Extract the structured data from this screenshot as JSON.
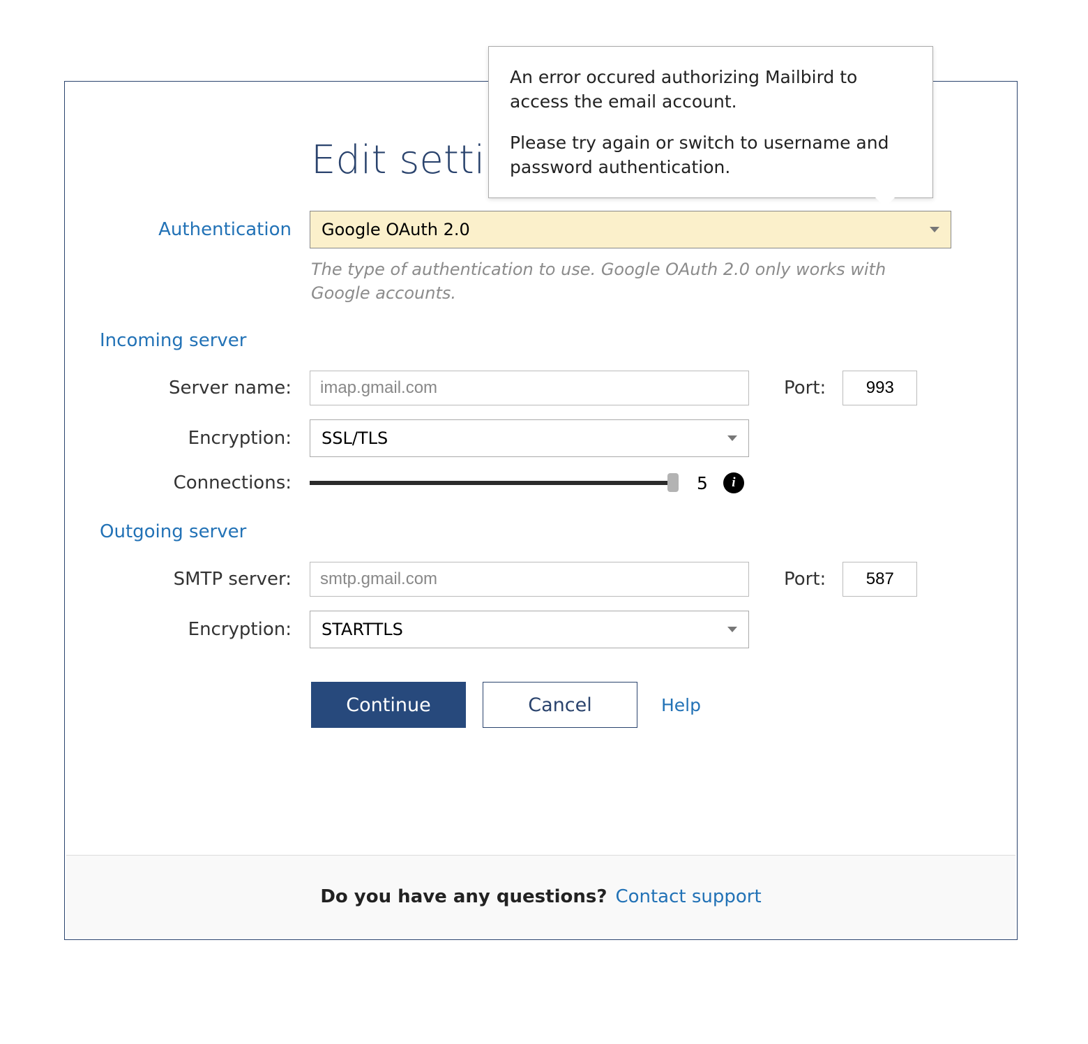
{
  "title": "Edit settings",
  "tooltip": {
    "line1": "An error occured authorizing Mailbird to access the email account.",
    "line2": "Please try again or switch to username and password authentication."
  },
  "auth": {
    "label": "Authentication",
    "value": "Google OAuth 2.0",
    "helper": "The type of authentication to use. Google OAuth 2.0 only works with Google accounts."
  },
  "incoming": {
    "header": "Incoming server",
    "server_label": "Server name:",
    "server_value": "imap.gmail.com",
    "port_label": "Port:",
    "port_value": "993",
    "encryption_label": "Encryption:",
    "encryption_value": "SSL/TLS",
    "connections_label": "Connections:",
    "connections_value": "5"
  },
  "outgoing": {
    "header": "Outgoing server",
    "server_label": "SMTP server:",
    "server_value": "smtp.gmail.com",
    "port_label": "Port:",
    "port_value": "587",
    "encryption_label": "Encryption:",
    "encryption_value": "STARTTLS"
  },
  "buttons": {
    "continue": "Continue",
    "cancel": "Cancel",
    "help": "Help"
  },
  "footer": {
    "question": "Do you have any questions?",
    "link": "Contact support"
  }
}
